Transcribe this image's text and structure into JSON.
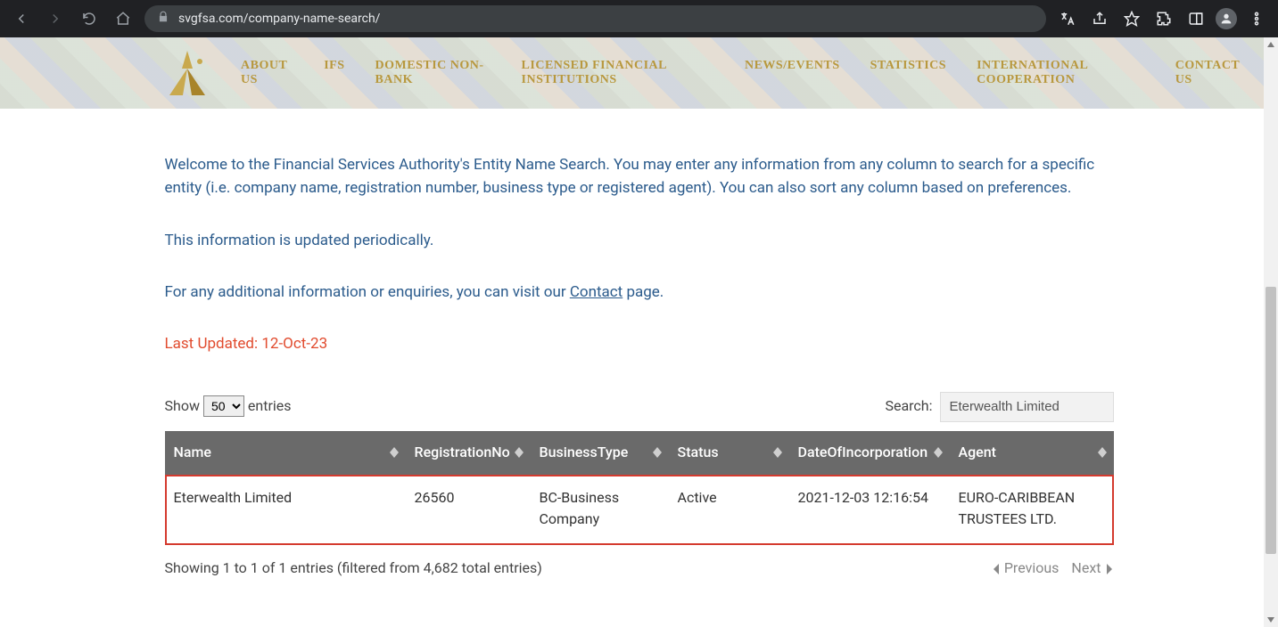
{
  "browser": {
    "url": "svgfsa.com/company-name-search/"
  },
  "nav": {
    "items": [
      "ABOUT US",
      "IFS",
      "DOMESTIC NON-BANK",
      "LICENSED FINANCIAL INSTITUTIONS",
      "NEWS/EVENTS",
      "STATISTICS",
      "INTERNATIONAL COOPERATION",
      "CONTACT US"
    ]
  },
  "intro": {
    "p1": "Welcome to the Financial Services Authority's Entity Name Search. You may enter any information from any column to search for a specific entity (i.e. company name, registration number, business type or registered agent). You can also sort any column based on preferences.",
    "p2": "This information is updated periodically.",
    "p3_pre": "For any additional information or enquiries, you can visit our ",
    "p3_link": "Contact",
    "p3_post": " page."
  },
  "last_updated": "Last Updated:  12-Oct-23",
  "table_controls": {
    "show_label_pre": "Show ",
    "show_value": "50",
    "show_label_post": " entries",
    "search_label": "Search:",
    "search_value": "Eterwealth Limited"
  },
  "table": {
    "columns": [
      "Name",
      "RegistrationNo",
      "BusinessType",
      "Status",
      "DateOfIncorporation",
      "Agent"
    ],
    "rows": [
      {
        "name": "Eterwealth Limited",
        "regno": "26560",
        "btype": "BC-Business Company",
        "status": "Active",
        "date": "2021-12-03 12:16:54",
        "agent": "EURO-CARIBBEAN TRUSTEES LTD."
      }
    ]
  },
  "footer": {
    "info": "Showing 1 to 1 of 1 entries (filtered from 4,682 total entries)",
    "prev": "Previous",
    "next": "Next"
  }
}
